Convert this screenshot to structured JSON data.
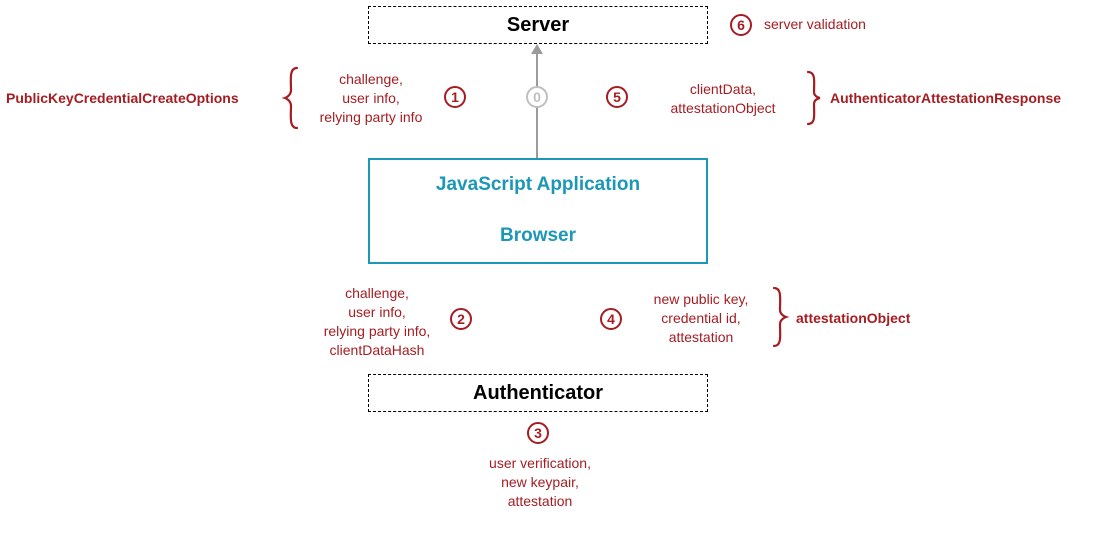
{
  "boxes": {
    "server": "Server",
    "js_app": "JavaScript Application",
    "browser": "Browser",
    "authenticator": "Authenticator"
  },
  "steps": {
    "s0": "0",
    "s1": "1",
    "s2": "2",
    "s3": "3",
    "s4": "4",
    "s5": "5",
    "s6": "6"
  },
  "labels": {
    "pkcco": "PublicKeyCredentialCreateOptions",
    "aar": "AuthenticatorAttestationResponse",
    "attestation_object": "attestationObject",
    "server_validation": "server validation"
  },
  "lists": {
    "step1": [
      "challenge,",
      "user info,",
      "relying party info"
    ],
    "step5": [
      "clientData,",
      "attestationObject"
    ],
    "step2": [
      "challenge,",
      "user info,",
      "relying party info,",
      "clientDataHash"
    ],
    "step4": [
      "new public key,",
      "credential id,",
      "attestation"
    ],
    "step3": [
      "user verification,",
      "new keypair,",
      "attestation"
    ]
  }
}
